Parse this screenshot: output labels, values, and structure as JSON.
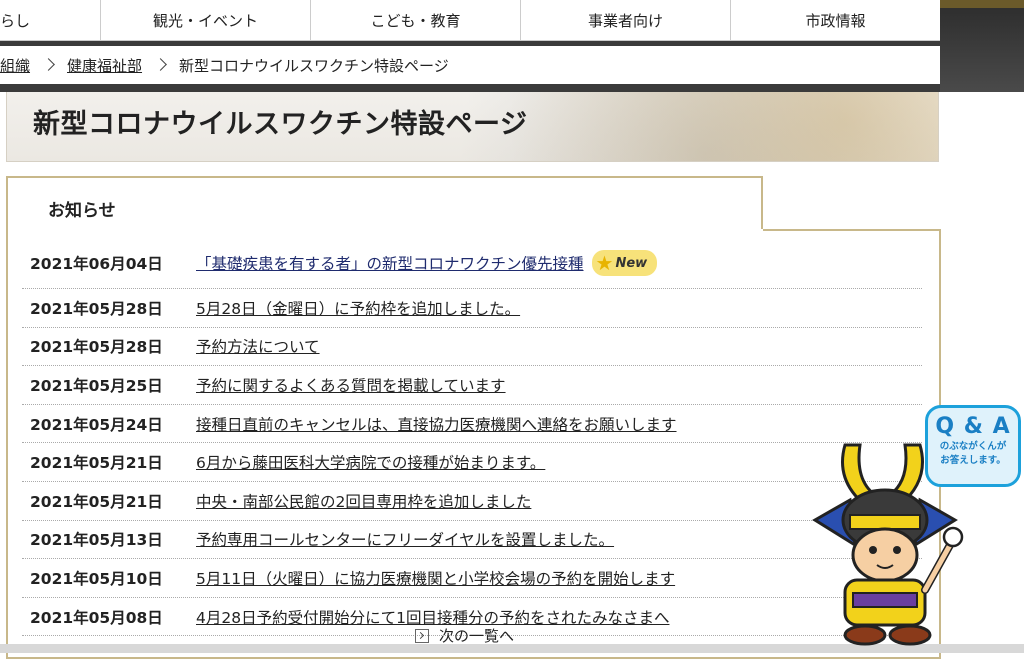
{
  "nav": {
    "items": [
      "らし",
      "観光・イベント",
      "こども・教育",
      "事業者向け",
      "市政情報"
    ]
  },
  "breadcrumb": {
    "items": [
      "組織",
      "健康福祉部",
      "新型コロナウイルスワクチン特設ページ"
    ]
  },
  "page": {
    "title": "新型コロナウイルスワクチン特設ページ"
  },
  "news": {
    "heading": "お知らせ",
    "new_badge": "New",
    "items": [
      {
        "date": "2021年06月04日",
        "title": "「基礎疾患を有する者」の新型コロナワクチン優先接種",
        "new": true
      },
      {
        "date": "2021年05月28日",
        "title": "5月28日（金曜日）に予約枠を追加しました。"
      },
      {
        "date": "2021年05月28日",
        "title": "予約方法について"
      },
      {
        "date": "2021年05月25日",
        "title": "予約に関するよくある質問を掲載しています"
      },
      {
        "date": "2021年05月24日",
        "title": "接種日直前のキャンセルは、直接協力医療機関へ連絡をお願いします"
      },
      {
        "date": "2021年05月21日",
        "title": "6月から藤田医科大学病院での接種が始まります。"
      },
      {
        "date": "2021年05月21日",
        "title": "中央・南部公民館の2回目専用枠を追加しました"
      },
      {
        "date": "2021年05月13日",
        "title": "予約専用コールセンターにフリーダイヤルを設置しました。"
      },
      {
        "date": "2021年05月10日",
        "title": "5月11日（火曜日）に協力医療機関と小学校会場の予約を開始します"
      },
      {
        "date": "2021年05月08日",
        "title": "4月28日予約受付開始分にて1回目接種分の予約をされたみなさまへ"
      }
    ],
    "more_label": "次の一覧へ"
  },
  "qa": {
    "title": "Q & A",
    "subtitle_line1": "のぶながくんが",
    "subtitle_line2": "お答えします。"
  }
}
